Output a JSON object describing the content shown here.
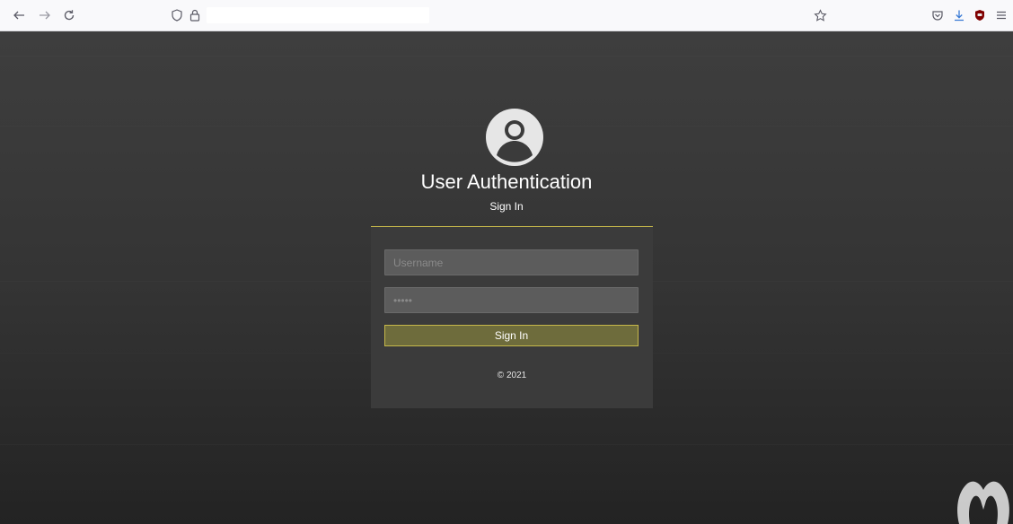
{
  "browser": {
    "nav": {
      "back_icon": "arrow-left-icon",
      "forward_icon": "arrow-right-icon",
      "reload_icon": "reload-icon"
    },
    "urlbar": {
      "tracking_icon": "shield-outline-icon",
      "lock_icon": "lock-icon",
      "url": ""
    },
    "right_icons": [
      "bookmark-star-icon",
      "pocket-icon",
      "download-icon",
      "ublock-origin-icon",
      "menu-icon"
    ]
  },
  "page": {
    "title": "User Authentication",
    "subtitle": "Sign In",
    "form": {
      "username_placeholder": "Username",
      "password_placeholder": "•••••",
      "signin_label": "Sign In"
    },
    "copyright": "© 2021",
    "accent_color": "#c6b84a"
  }
}
